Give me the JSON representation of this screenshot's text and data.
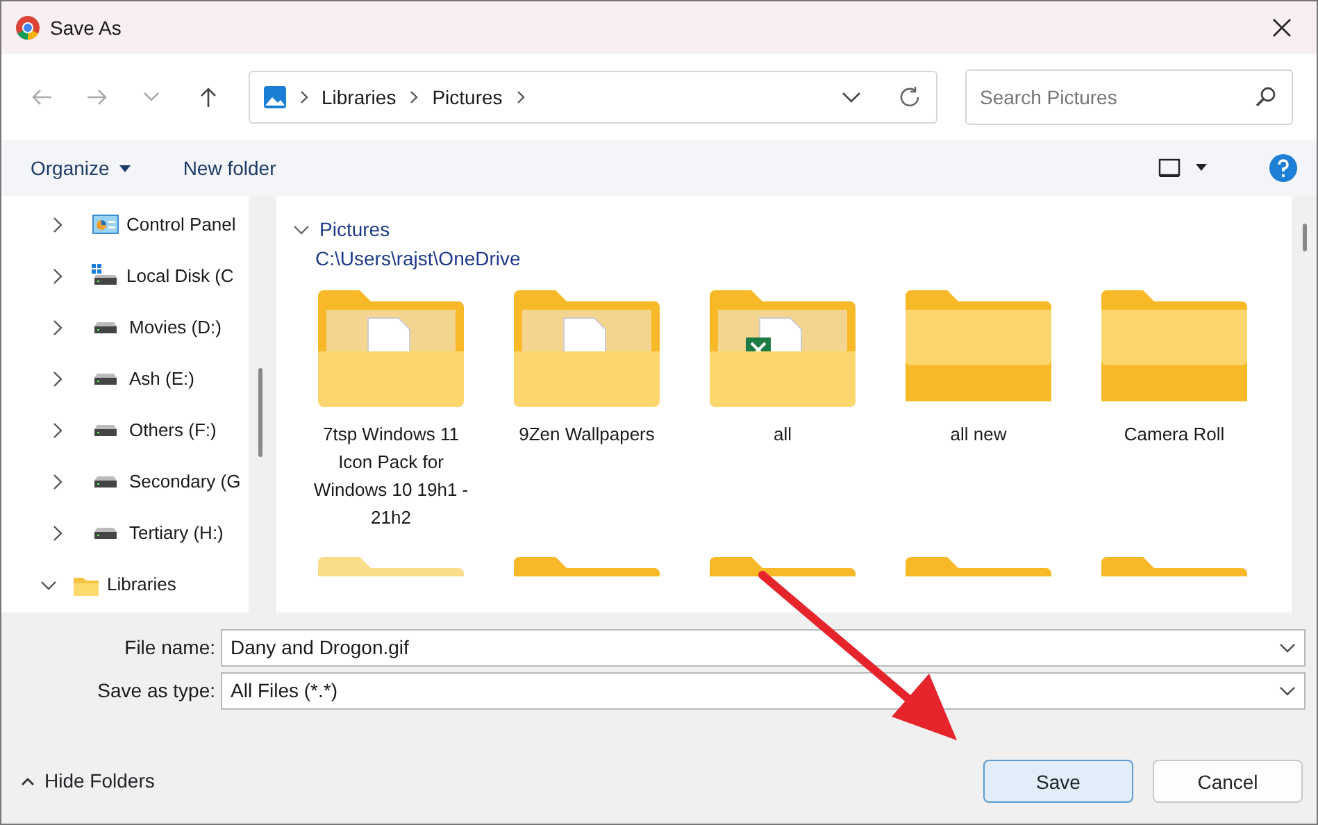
{
  "window": {
    "title": "Save As"
  },
  "address": {
    "crumbs": [
      "Libraries",
      "Pictures"
    ]
  },
  "search": {
    "placeholder": "Search Pictures"
  },
  "commands": {
    "organize": "Organize",
    "new_folder": "New folder"
  },
  "tree": [
    {
      "label": "Control Panel",
      "kind": "control-panel",
      "expanded": false
    },
    {
      "label": "Local Disk (C",
      "kind": "system-drive",
      "expanded": false
    },
    {
      "label": "Movies (D:)",
      "kind": "drive",
      "expanded": false
    },
    {
      "label": "Ash (E:)",
      "kind": "drive",
      "expanded": false
    },
    {
      "label": "Others (F:)",
      "kind": "drive",
      "expanded": false
    },
    {
      "label": "Secondary (G",
      "kind": "drive",
      "expanded": false
    },
    {
      "label": "Tertiary (H:)",
      "kind": "drive",
      "expanded": false
    },
    {
      "label": "Libraries",
      "kind": "library",
      "expanded": true
    }
  ],
  "group": {
    "title": "Pictures",
    "path": "C:\\Users\\rajst\\OneDrive"
  },
  "folders": [
    {
      "name": "7tsp Windows 11 Icon Pack for Windows 10 19h1 - 21h2",
      "kind": "document"
    },
    {
      "name": "9Zen Wallpapers",
      "kind": "document"
    },
    {
      "name": "all",
      "kind": "spreadsheet"
    },
    {
      "name": "all new",
      "kind": "empty"
    },
    {
      "name": "Camera Roll",
      "kind": "empty"
    }
  ],
  "more_folders": [
    {
      "kind": "faded"
    },
    {
      "kind": "normal"
    },
    {
      "kind": "normal"
    },
    {
      "kind": "normal"
    },
    {
      "kind": "normal"
    }
  ],
  "fields": [
    {
      "label": "File name:",
      "value": "Dany and Drogon.gif"
    },
    {
      "label": "Save as type:",
      "value": "All Files (*.*)"
    }
  ],
  "hide_folders": "Hide Folders",
  "buttons": [
    {
      "label": "Save",
      "kind": "primary"
    },
    {
      "label": "Cancel",
      "kind": "secondary"
    }
  ]
}
